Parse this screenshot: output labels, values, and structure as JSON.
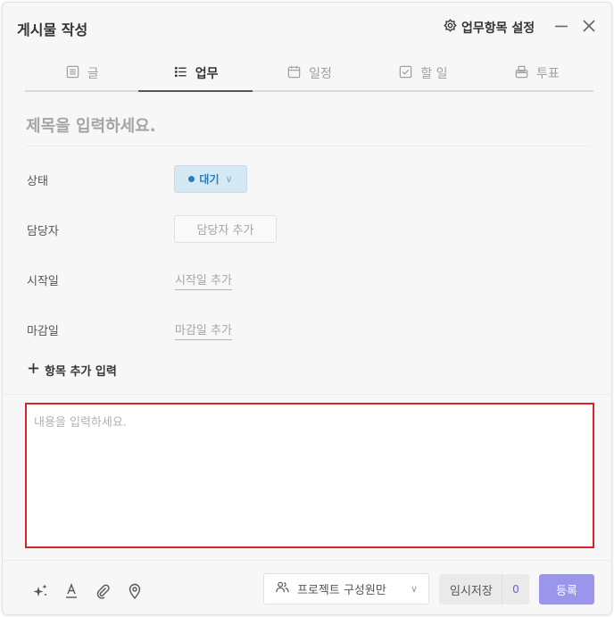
{
  "dialog": {
    "title": "게시물 작성",
    "settings_label": "업무항목 설정"
  },
  "tabs": [
    {
      "label": "글",
      "icon": "document-icon",
      "active": false
    },
    {
      "label": "업무",
      "icon": "list-icon",
      "active": true
    },
    {
      "label": "일정",
      "icon": "calendar-icon",
      "active": false
    },
    {
      "label": "할 일",
      "icon": "checkbox-icon",
      "active": false
    },
    {
      "label": "투표",
      "icon": "ballot-box-icon",
      "active": false
    }
  ],
  "form": {
    "subject_placeholder": "제목을 입력하세요.",
    "status": {
      "label": "상태",
      "value": "대기",
      "color": "#2c7bb6",
      "background": "#d5e9f5"
    },
    "assignee": {
      "label": "담당자",
      "button": "담당자 추가"
    },
    "start_date": {
      "label": "시작일",
      "link": "시작일 추가"
    },
    "due_date": {
      "label": "마감일",
      "link": "마감일 추가"
    },
    "add_item": "항목 추가 입력",
    "content_placeholder": "내용을 입력하세요."
  },
  "footer": {
    "tools": [
      "ai-sparkle-icon",
      "text-format-icon",
      "attachment-icon",
      "location-pin-icon"
    ],
    "scope": "프로젝트 구성원만",
    "draft_label": "임시저장",
    "draft_count": "0",
    "submit_label": "등록",
    "submit_color": "#9c95ec"
  }
}
